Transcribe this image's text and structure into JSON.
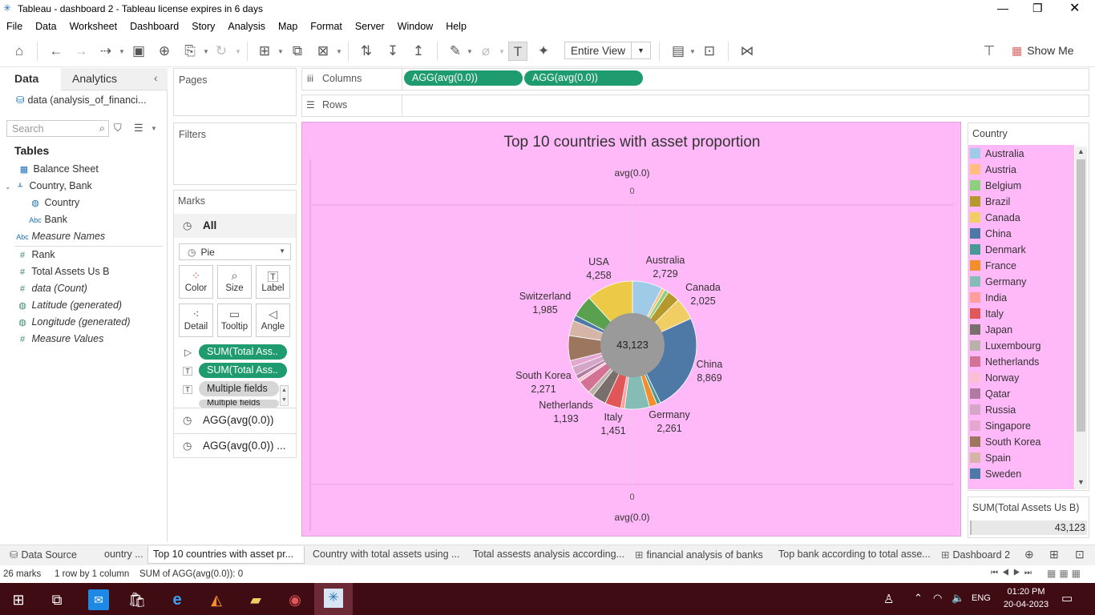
{
  "window": {
    "title": "Tableau - dashboard 2 - Tableau license expires in 6 days"
  },
  "menu": [
    "File",
    "Data",
    "Worksheet",
    "Dashboard",
    "Story",
    "Analysis",
    "Map",
    "Format",
    "Server",
    "Window",
    "Help"
  ],
  "toolbar": {
    "fit": "Entire View",
    "show_me": "Show Me"
  },
  "left": {
    "tab_data": "Data",
    "tab_analytics": "Analytics",
    "datasource": "data (analysis_of_financi...",
    "search_placeholder": "Search",
    "tables_label": "Tables",
    "fields": [
      "Balance Sheet",
      "Country, Bank",
      "Country",
      "Bank",
      "Measure Names",
      "Rank",
      "Total Assets Us B",
      "data (Count)",
      "Latitude (generated)",
      "Longitude (generated)",
      "Measure Values"
    ]
  },
  "shelves": {
    "pages": "Pages",
    "filters": "Filters",
    "columns": "Columns",
    "rows": "Rows",
    "col_pill1": "AGG(avg(0.0))",
    "col_pill2": "AGG(avg(0.0))"
  },
  "marks": {
    "title": "Marks",
    "all": "All",
    "type": "Pie",
    "color": "Color",
    "size": "Size",
    "label": "Label",
    "detail": "Detail",
    "tooltip": "Tooltip",
    "angle": "Angle",
    "pill1": "SUM(Total Ass..",
    "pill2": "SUM(Total Ass..",
    "pill3": "Multiple fields",
    "pill4": "Multiple fields",
    "agg1": "AGG(avg(0.0))",
    "agg2": "AGG(avg(0.0)) ..."
  },
  "chart": {
    "title": "Top 10 countries with asset proportion",
    "axis_top_label": "avg(0.0)",
    "axis_top_tick": "0",
    "axis_bottom_tick": "0",
    "axis_bottom_label": "avg(0.0)",
    "center_value": "43,123",
    "labels": [
      {
        "name": "Australia",
        "value": "2,729"
      },
      {
        "name": "Canada",
        "value": "2,025"
      },
      {
        "name": "China",
        "value": "8,869"
      },
      {
        "name": "Germany",
        "value": "2,261"
      },
      {
        "name": "Italy",
        "value": "1,451"
      },
      {
        "name": "Netherlands",
        "value": "1,193"
      },
      {
        "name": "South Korea",
        "value": "2,271"
      },
      {
        "name": "Switzerland",
        "value": "1,985"
      },
      {
        "name": "USA",
        "value": "4,258"
      }
    ]
  },
  "chart_data": {
    "type": "pie",
    "title": "Top 10 countries with asset proportion",
    "total": 43123,
    "categories": [
      "Australia",
      "Austria",
      "Belgium",
      "Brazil",
      "Canada",
      "China",
      "Denmark",
      "France",
      "Germany",
      "India",
      "Italy",
      "Japan",
      "Luxembourg",
      "Netherlands",
      "Norway",
      "Qatar",
      "Russia",
      "Singapore",
      "South Korea",
      "Spain",
      "Sweden",
      "Switzerland",
      "USA"
    ],
    "values": [
      2729,
      300,
      400,
      1100,
      2025,
      8869,
      350,
      700,
      2261,
      350,
      1451,
      1300,
      500,
      1193,
      300,
      400,
      800,
      600,
      2271,
      1400,
      500,
      1985,
      4258
    ],
    "legend": "right"
  },
  "legend": {
    "title": "Country",
    "items": [
      {
        "name": "Australia",
        "color": "#a0cbe8"
      },
      {
        "name": "Austria",
        "color": "#ffbe7d"
      },
      {
        "name": "Belgium",
        "color": "#8cd17d"
      },
      {
        "name": "Brazil",
        "color": "#b6992d"
      },
      {
        "name": "Canada",
        "color": "#f1ce63"
      },
      {
        "name": "China",
        "color": "#4e79a7"
      },
      {
        "name": "Denmark",
        "color": "#499894"
      },
      {
        "name": "France",
        "color": "#f28e2b"
      },
      {
        "name": "Germany",
        "color": "#86bcb6"
      },
      {
        "name": "India",
        "color": "#ff9d9a"
      },
      {
        "name": "Italy",
        "color": "#e15759"
      },
      {
        "name": "Japan",
        "color": "#79706e"
      },
      {
        "name": "Luxembourg",
        "color": "#bab0ac"
      },
      {
        "name": "Netherlands",
        "color": "#d37295"
      },
      {
        "name": "Norway",
        "color": "#fabfd2"
      },
      {
        "name": "Qatar",
        "color": "#b07aa1"
      },
      {
        "name": "Russia",
        "color": "#d4a6c8"
      },
      {
        "name": "Singapore",
        "color": "#e3a7d0"
      },
      {
        "name": "South Korea",
        "color": "#9d7660"
      },
      {
        "name": "Spain",
        "color": "#d7b5a6"
      },
      {
        "name": "Sweden",
        "color": "#4e79a7"
      },
      {
        "name": "Switzerland",
        "color": "#59a14f"
      },
      {
        "name": "USA",
        "color": "#edc948"
      }
    ],
    "size_title": "SUM(Total Assets Us B)",
    "size_value": "43,123"
  },
  "tabs": [
    "Data Source",
    "ountry ...",
    "Top 10 countries with asset pr...",
    "Country with total assets using ...",
    "Total assests analysis according...",
    "financial analysis of banks",
    "Top bank according to total asse...",
    "Dashboard 2"
  ],
  "status": {
    "marks": "26 marks",
    "rows": "1 row by 1 column",
    "sum": "SUM of AGG(avg(0.0)): 0"
  },
  "taskbar": {
    "lang": "ENG",
    "time": "01:20 PM",
    "date": "20-04-2023"
  }
}
